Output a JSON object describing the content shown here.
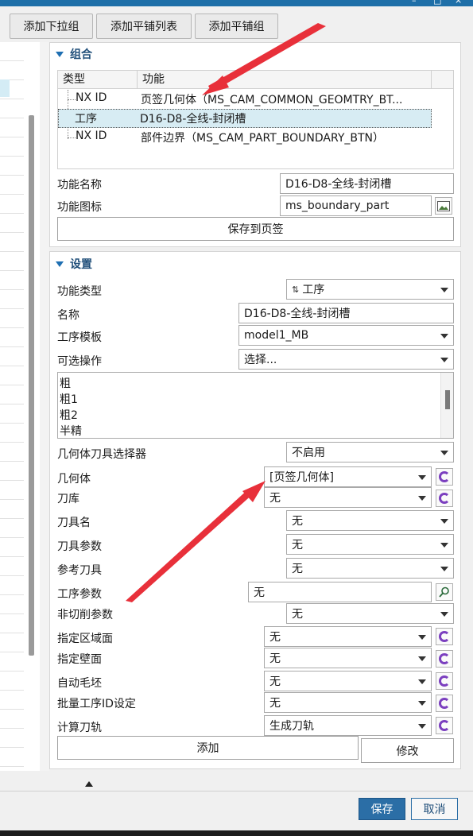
{
  "window": {
    "controls": [
      "–",
      "□",
      "×"
    ]
  },
  "toolbar": {
    "add_dropdown": "添加下拉组",
    "add_tile_list": "添加平铺列表",
    "add_tile_group": "添加平铺组"
  },
  "group_section": {
    "title": "组合",
    "table": {
      "headers": [
        "类型",
        "功能"
      ],
      "rows": [
        {
          "type": "NX ID",
          "function": "页签几何体（MS_CAM_COMMON_GEOMTRY_BT..."
        },
        {
          "type": "工序",
          "function": "D16-D8-全线-封闭槽"
        },
        {
          "type": "NX ID",
          "function": "部件边界（MS_CAM_PART_BOUNDARY_BTN）"
        }
      ]
    },
    "func_name_label": "功能名称",
    "func_name_value": "D16-D8-全线-封闭槽",
    "func_icon_label": "功能图标",
    "func_icon_value": "ms_boundary_part",
    "save_to_tab": "保存到页签"
  },
  "settings_section": {
    "title": "设置",
    "func_type_label": "功能类型",
    "func_type_value": "工序",
    "name_label": "名称",
    "name_value": "D16-D8-全线-封闭槽",
    "op_template_label": "工序模板",
    "op_template_value": "model1_MB",
    "optional_op_label": "可选操作",
    "optional_op_value": "选择...",
    "list_items": [
      "粗",
      "粗1",
      "粗2",
      "半精"
    ],
    "geom_tool_selector_label": "几何体刀具选择器",
    "geom_tool_selector_value": "不启用",
    "geometry_label": "几何体",
    "geometry_value": "[页签几何体]",
    "tool_lib_label": "刀库",
    "tool_lib_value": "无",
    "tool_name_label": "刀具名",
    "tool_name_value": "无",
    "tool_params_label": "刀具参数",
    "tool_params_value": "无",
    "ref_tool_label": "参考刀具",
    "ref_tool_value": "无",
    "op_params_label": "工序参数",
    "op_params_value": "无",
    "noncut_params_label": "非切削参数",
    "noncut_params_value": "无",
    "cut_area_label": "指定区域面",
    "cut_area_value": "无",
    "wall_label": "指定壁面",
    "wall_value": "无",
    "auto_blank_label": "自动毛坯",
    "auto_blank_value": "无",
    "batch_id_label": "批量工序ID设定",
    "batch_id_value": "无",
    "calc_path_label": "计算刀轨",
    "calc_path_value": "生成刀轨",
    "add_button": "添加",
    "modify_button": "修改"
  },
  "footer": {
    "save": "保存",
    "cancel": "取消"
  },
  "colors": {
    "accent": "#2b6ea6",
    "selection": "#d7ecf3",
    "annotation_arrow": "#e8303a"
  }
}
